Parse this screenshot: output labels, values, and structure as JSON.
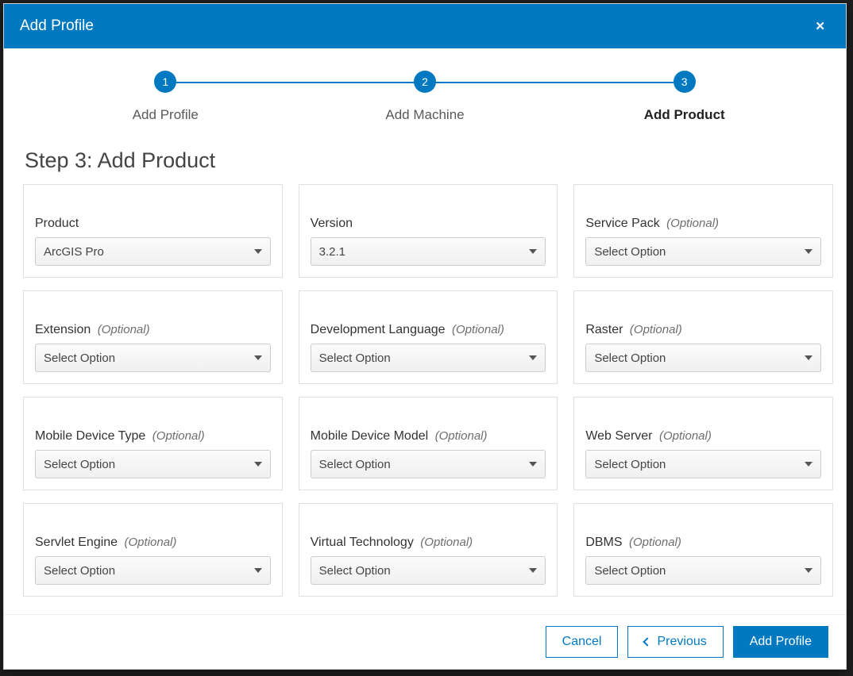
{
  "modal": {
    "title": "Add Profile"
  },
  "steps": [
    {
      "num": "1",
      "label": "Add Profile"
    },
    {
      "num": "2",
      "label": "Add Machine"
    },
    {
      "num": "3",
      "label": "Add Product"
    }
  ],
  "stepTitle": "Step 3: Add Product",
  "optionalText": "(Optional)",
  "placeholder": "Select Option",
  "fields": [
    {
      "label": "Product",
      "value": "ArcGIS Pro",
      "optional": false
    },
    {
      "label": "Version",
      "value": "3.2.1",
      "optional": false
    },
    {
      "label": "Service Pack",
      "value": "Select Option",
      "optional": true
    },
    {
      "label": "Extension",
      "value": "Select Option",
      "optional": true
    },
    {
      "label": "Development Language",
      "value": "Select Option",
      "optional": true
    },
    {
      "label": "Raster",
      "value": "Select Option",
      "optional": true
    },
    {
      "label": "Mobile Device Type",
      "value": "Select Option",
      "optional": true
    },
    {
      "label": "Mobile Device Model",
      "value": "Select Option",
      "optional": true
    },
    {
      "label": "Web Server",
      "value": "Select Option",
      "optional": true
    },
    {
      "label": "Servlet Engine",
      "value": "Select Option",
      "optional": true
    },
    {
      "label": "Virtual Technology",
      "value": "Select Option",
      "optional": true
    },
    {
      "label": "DBMS",
      "value": "Select Option",
      "optional": true
    }
  ],
  "buttons": {
    "cancel": "Cancel",
    "previous": "Previous",
    "submit": "Add Profile"
  }
}
